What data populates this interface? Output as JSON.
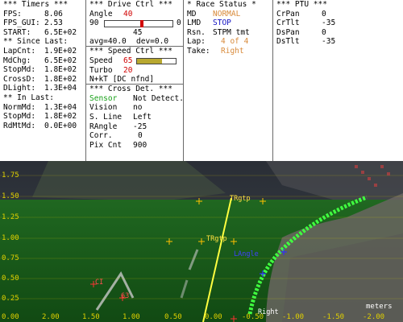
{
  "timers": {
    "title": "*** Timers ***",
    "fps_label": "FPS:",
    "fps": "8.06",
    "fpsgui_label": "FPS_GUI:",
    "fpsgui": "2.53",
    "start_label": "START:",
    "start": "6.5E+02",
    "since_title": "** Since Last:",
    "since": [
      {
        "k": "LapCnt:",
        "v": "1.9E+02"
      },
      {
        "k": "MdChg:",
        "v": "6.5E+02"
      },
      {
        "k": "StopMd:",
        "v": "1.8E+02"
      },
      {
        "k": "CrossD:",
        "v": "1.8E+02"
      },
      {
        "k": "DLight:",
        "v": "1.3E+04"
      }
    ],
    "inlast_title": "** In Last:",
    "inlast": [
      {
        "k": "NormMd:",
        "v": "1.3E+04"
      },
      {
        "k": "StopMd:",
        "v": "1.8E+02"
      },
      {
        "k": "RdMtMd:",
        "v": "0.0E+00"
      }
    ]
  },
  "drive": {
    "title": "***  Drive Ctrl  ***",
    "angle_label": "Angle",
    "angle": "40",
    "slider_min": "90",
    "slider_max": "0",
    "slider_mid": "45",
    "avg": "avg=40.0",
    "dev": "dev=0.0",
    "angle_fraction": 0.55
  },
  "speed": {
    "title": "***  Speed Ctrl  ***",
    "speed_label": "Speed",
    "speed": "65",
    "speed_fraction": 0.65,
    "turbo_label": "Turbo",
    "turbo": "20",
    "nkt": "N+kT [DC nfnd]"
  },
  "cross": {
    "title": "*** Cross Det. ***",
    "sensor_label": "Sensor",
    "sensor": "Not Detect.",
    "vision_label": "Vision",
    "vision": "no",
    "sline_label": "S. Line",
    "sline": "Left",
    "rangle_label": "RAngle",
    "rangle": "-25",
    "corr_label": "Corr.",
    "corr": "0",
    "pix_label": "Pix Cnt",
    "pix": "900"
  },
  "race": {
    "title": "* Race Status *",
    "md_label": "MD",
    "md": "NORMAL",
    "lmd_label": "LMD",
    "lmd": "STOP",
    "rsn_label": "Rsn.",
    "rsn": "STPM tmt",
    "lap_label": "Lap:",
    "lap": "4 of 4",
    "take_label": "Take:",
    "take": "Right"
  },
  "ptu": {
    "title": "*** PTU ***",
    "rows": [
      {
        "k": "CrPan",
        "v": "0"
      },
      {
        "k": "CrTlt",
        "v": "-35"
      },
      {
        "k": "DsPan",
        "v": "0"
      },
      {
        "k": "DsTlt",
        "v": "-35"
      }
    ]
  },
  "view": {
    "y_ticks": [
      "1.75",
      "1.50",
      "1.25",
      "1.00",
      "0.75",
      "0.50",
      "0.25",
      "0.00"
    ],
    "x_ticks": [
      "2.00",
      "1.50",
      "1.00",
      "0.50",
      "0.00",
      "-0.50",
      "-1.00",
      "-1.50",
      "-2.00"
    ],
    "units": "meters",
    "labels": {
      "trgtp_upper": "TRgtp",
      "trgtp_lower": "TRgtp",
      "langle": "LAngle",
      "right": "Right",
      "num": "63",
      "ci": "CI"
    }
  }
}
